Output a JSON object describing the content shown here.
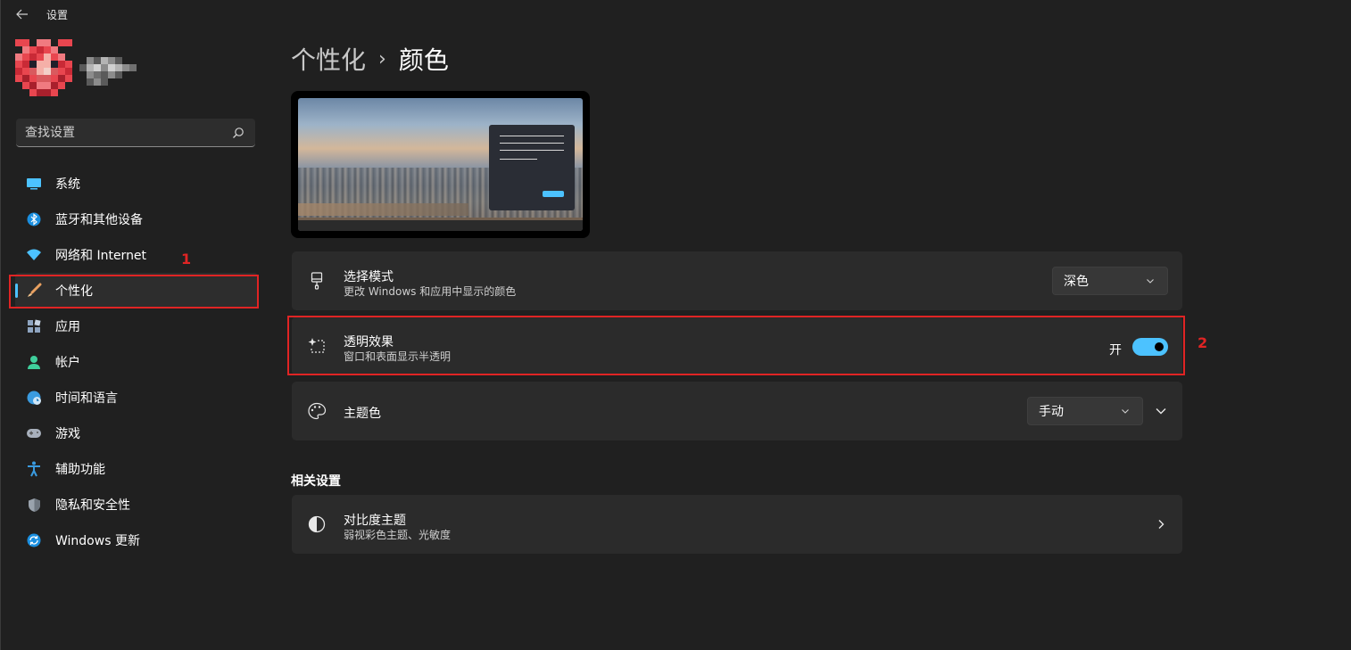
{
  "window": {
    "title": "设置"
  },
  "search": {
    "placeholder": "查找设置"
  },
  "sidebar": {
    "items": [
      {
        "label": "系统",
        "icon": "monitor-icon"
      },
      {
        "label": "蓝牙和其他设备",
        "icon": "bluetooth-icon"
      },
      {
        "label": "网络和 Internet",
        "icon": "wifi-icon"
      },
      {
        "label": "个性化",
        "icon": "paintbrush-icon",
        "active": true
      },
      {
        "label": "应用",
        "icon": "apps-icon"
      },
      {
        "label": "帐户",
        "icon": "person-icon"
      },
      {
        "label": "时间和语言",
        "icon": "globe-clock-icon"
      },
      {
        "label": "游戏",
        "icon": "gamepad-icon"
      },
      {
        "label": "辅助功能",
        "icon": "accessibility-icon"
      },
      {
        "label": "隐私和安全性",
        "icon": "shield-icon"
      },
      {
        "label": "Windows 更新",
        "icon": "update-icon"
      }
    ]
  },
  "annotations": {
    "first": "1",
    "second": "2"
  },
  "breadcrumb": {
    "parent": "个性化",
    "separator": "›",
    "current": "颜色"
  },
  "settings": {
    "mode": {
      "title": "选择模式",
      "subtitle": "更改 Windows 和应用中显示的颜色",
      "value": "深色",
      "icon": "paintbrush-mode-icon"
    },
    "transparency": {
      "title": "透明效果",
      "subtitle": "窗口和表面显示半透明",
      "state_label": "开",
      "on": true,
      "icon": "sparkle-icon"
    },
    "accent": {
      "title": "主题色",
      "value": "手动",
      "icon": "palette-icon"
    }
  },
  "related": {
    "heading": "相关设置",
    "contrast": {
      "title": "对比度主题",
      "subtitle": "弱视彩色主题、光敏度",
      "icon": "contrast-icon"
    }
  },
  "colors": {
    "accent": "#4cc2ff",
    "background": "#202020",
    "card": "#2b2b2b",
    "annotation": "#e02424"
  }
}
